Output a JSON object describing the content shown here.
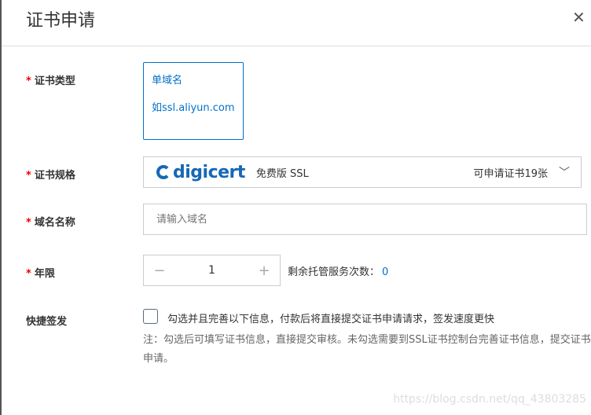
{
  "dialog": {
    "title": "证书申请",
    "close_icon": "close-icon"
  },
  "form": {
    "cert_type": {
      "label": "证书类型",
      "option_title": "单域名",
      "option_example": "如ssl.aliyun.com"
    },
    "cert_spec": {
      "label": "证书规格",
      "brand": "digicert",
      "product": "免费版 SSL",
      "available": "可申请证书19张"
    },
    "domain": {
      "label": "域名名称",
      "placeholder": "请输入域名",
      "value": ""
    },
    "years": {
      "label": "年限",
      "value": "1",
      "minus": "−",
      "plus": "+",
      "remain_label": "剩余托管服务次数：",
      "remain_value": "0"
    },
    "quick": {
      "label": "快捷签发",
      "checked": false,
      "checkbox_text": "勾选并且完善以下信息，付款后将直接提交证书申请请求，签发速度更快",
      "note": "注：勾选后可填写证书信息，直接提交审核。未勾选需要到SSL证书控制台完善证书信息，提交证书申请。"
    }
  },
  "required_mark": "*",
  "watermark": "https://blog.csdn.net/qq_43803285"
}
